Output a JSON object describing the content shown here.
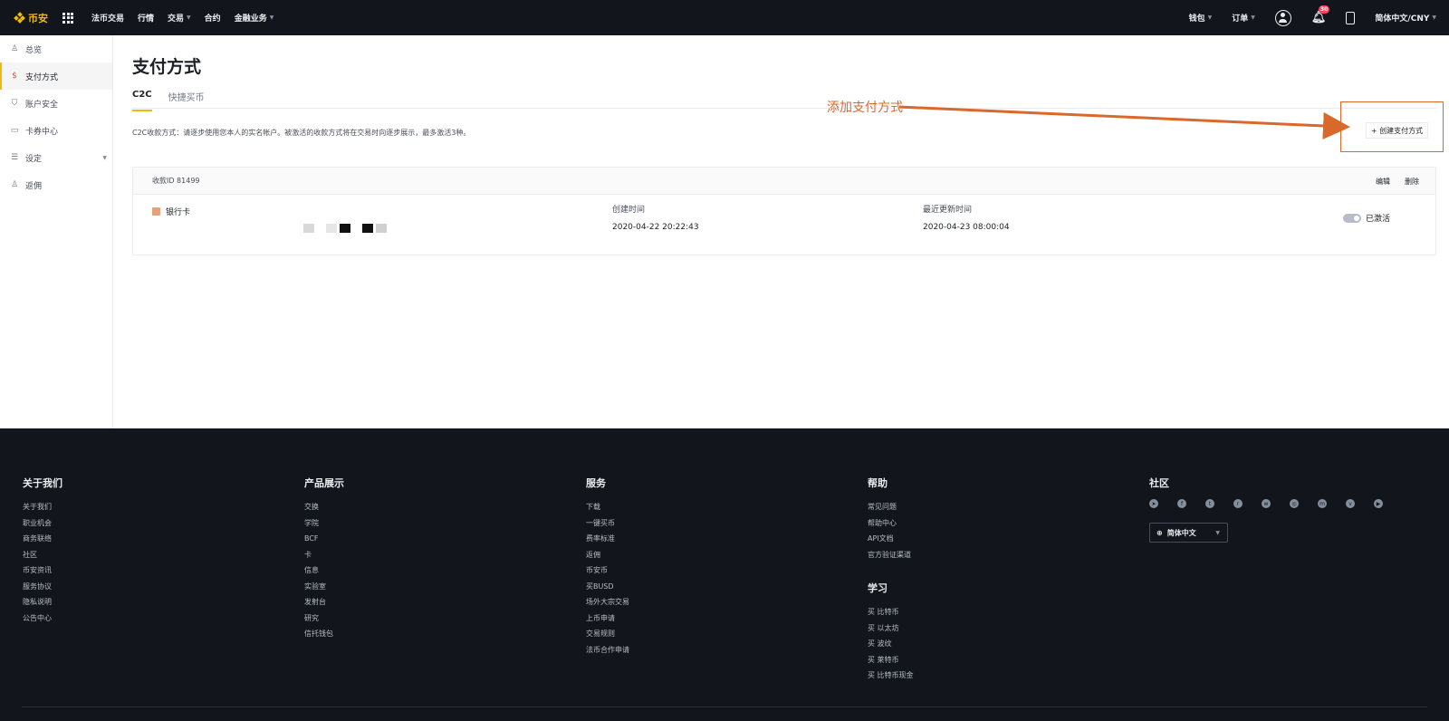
{
  "topbar": {
    "logo_text": "币安",
    "nav": [
      "法币交易",
      "行情",
      "交易",
      "合约",
      "金融业务"
    ],
    "right": {
      "wallet": "钱包",
      "orders": "订单",
      "notification_count": "30",
      "language": "简体中文/CNY"
    }
  },
  "sidebar": {
    "items": [
      {
        "label": "总览",
        "icon": "user-icon"
      },
      {
        "label": "支付方式",
        "icon": "dollar-icon"
      },
      {
        "label": "账户安全",
        "icon": "shield-icon"
      },
      {
        "label": "卡券中心",
        "icon": "ticket-icon"
      },
      {
        "label": "设定",
        "icon": "sliders-icon"
      },
      {
        "label": "返佣",
        "icon": "add-user-icon"
      }
    ],
    "active_index": 1
  },
  "main": {
    "title": "支付方式",
    "tabs": [
      "C2C",
      "快捷买币"
    ],
    "note": "C2C收款方式：请逐步使用您本人的实名帐户。被激活的收款方式将在交易时向逐步展示，最多激活3种。",
    "annotation": "添加支付方式",
    "create_button": "+ 创建支付方式",
    "card": {
      "header_id": "收款ID 81499",
      "edit": "编辑",
      "delete": "删除",
      "method": "银行卡",
      "created_label": "创建时间",
      "created_value": "2020-04-22 20:22:43",
      "updated_label": "最近更新时间",
      "updated_value": "2020-04-23 08:00:04",
      "status": "已激活"
    }
  },
  "footer": {
    "about": {
      "title": "关于我们",
      "links": [
        "关于我们",
        "职业机会",
        "商务联络",
        "社区",
        "币安资讯",
        "服务协议",
        "隐私说明",
        "公告中心"
      ]
    },
    "products": {
      "title": "产品展示",
      "links": [
        "交换",
        "学院",
        "BCF",
        "卡",
        "信息",
        "实验室",
        "发射台",
        "研究",
        "信托钱包"
      ]
    },
    "services": {
      "title": "服务",
      "links": [
        "下载",
        "一键买币",
        "费率标准",
        "返佣",
        "币安币",
        "买BUSD",
        "场外大宗交易",
        "上币申请",
        "交易规则",
        "法币合作申请"
      ]
    },
    "help": {
      "title": "帮助",
      "links": [
        "常见问题",
        "帮助中心",
        "API文档",
        "官方验证渠道"
      ]
    },
    "learn": {
      "title": "学习",
      "links": [
        "买 比特币",
        "买 以太坊",
        "买 波纹",
        "买 莱特币",
        "买 比特币现金"
      ]
    },
    "community": {
      "title": "社区",
      "social_icons": [
        "telegram-icon",
        "facebook-icon",
        "twitter-icon",
        "reddit-icon",
        "weibo-icon",
        "instagram-icon",
        "coinmarketcap-icon",
        "vk-icon",
        "youtube-icon"
      ],
      "language": "简体中文"
    }
  },
  "colors": {
    "accent": "#f0b90b",
    "annotation": "#d9682b",
    "dark_bg": "#12161c"
  }
}
